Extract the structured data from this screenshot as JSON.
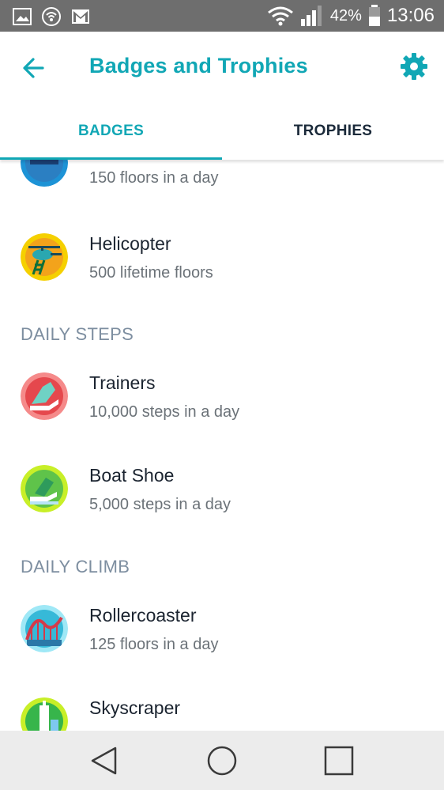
{
  "status_bar": {
    "battery": "42%",
    "time": "13:06",
    "left_icons": [
      "gallery-icon",
      "hotspot-icon",
      "gmail-icon"
    ],
    "right_icons": [
      "wifi-icon",
      "signal-icon",
      "battery-icon"
    ]
  },
  "app_bar": {
    "title": "Badges and Trophies",
    "back_icon": "arrow-left-icon",
    "settings_icon": "gear-icon"
  },
  "tabs": [
    {
      "label": "BADGES",
      "selected": true
    },
    {
      "label": "TROPHIES",
      "selected": false
    }
  ],
  "list": {
    "partial_item_top": {
      "subtitle": "150 floors in a day"
    },
    "items_group_1": [
      {
        "title": "Helicopter",
        "subtitle": "500 lifetime floors"
      }
    ],
    "sections": [
      {
        "header": "DAILY STEPS",
        "items": [
          {
            "title": "Trainers",
            "subtitle": "10,000 steps in a day"
          },
          {
            "title": "Boat Shoe",
            "subtitle": "5,000 steps in a day"
          }
        ]
      },
      {
        "header": "DAILY CLIMB",
        "items": [
          {
            "title": "Rollercoaster",
            "subtitle": "125 floors in a day"
          },
          {
            "title": "Skyscraper",
            "subtitle": ""
          }
        ]
      }
    ]
  },
  "nav_bar": {
    "icons": [
      "back-triangle-icon",
      "home-circle-icon",
      "recents-square-icon"
    ]
  },
  "colors": {
    "accent": "#11a7b5",
    "status_bar": "#6e6e6e",
    "nav_bar": "#ececec",
    "section_header": "#7d8ea0"
  }
}
